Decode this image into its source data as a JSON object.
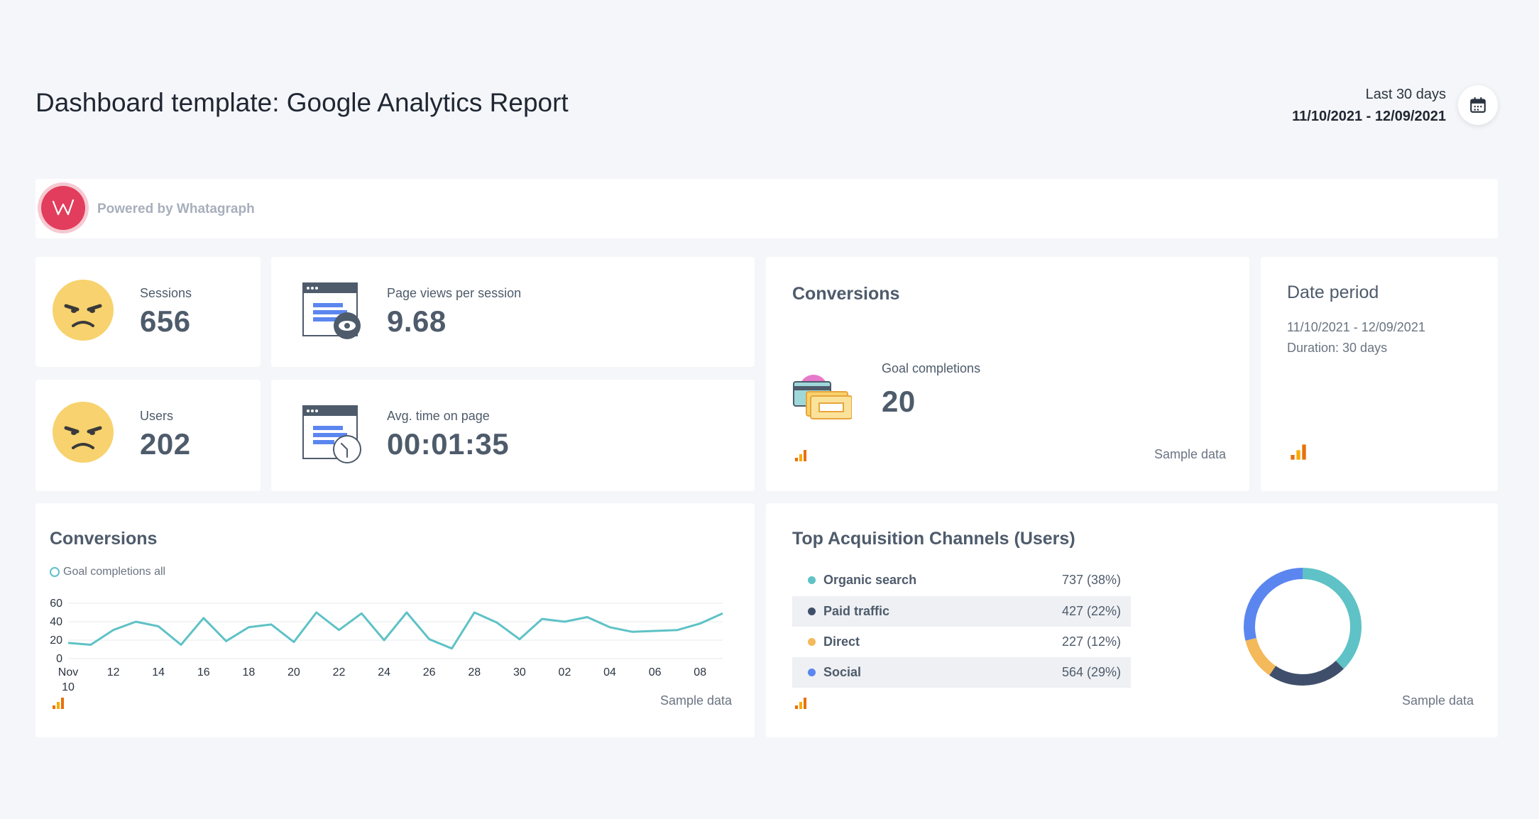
{
  "header": {
    "title": "Dashboard template: Google Analytics Report",
    "period_label": "Last 30 days",
    "period_range": "11/10/2021 - 12/09/2021"
  },
  "powered": {
    "text": "Powered by Whatagraph"
  },
  "kpis": {
    "sessions": {
      "label": "Sessions",
      "value": "656"
    },
    "pageviews": {
      "label": "Page views per session",
      "value": "9.68"
    },
    "users": {
      "label": "Users",
      "value": "202"
    },
    "avgtime": {
      "label": "Avg. time on page",
      "value": "00:01:35"
    }
  },
  "conversions_card": {
    "title": "Conversions",
    "metric_label": "Goal completions",
    "metric_value": "20",
    "sample": "Sample data"
  },
  "date_period": {
    "title": "Date period",
    "range": "11/10/2021 - 12/09/2021",
    "duration": "Duration:  30 days"
  },
  "conversions_chart": {
    "title": "Conversions",
    "legend": "Goal completions all",
    "sample": "Sample data",
    "x_tick_labels": [
      "Nov\n10",
      "12",
      "14",
      "16",
      "18",
      "20",
      "22",
      "24",
      "26",
      "28",
      "30",
      "02",
      "04",
      "06",
      "08"
    ],
    "y_tick_labels": [
      "60",
      "40",
      "20",
      "0"
    ]
  },
  "acquisition": {
    "title": "Top Acquisition Channels (Users)",
    "sample": "Sample data",
    "channels": [
      {
        "name": "Organic search",
        "value": "737  (38%)",
        "color": "#5ec2c6"
      },
      {
        "name": "Paid traffic",
        "value": "427  (22%)",
        "color": "#3f4f6b"
      },
      {
        "name": "Direct",
        "value": "227  (12%)",
        "color": "#f3b95a"
      },
      {
        "name": "Social",
        "value": "564  (29%)",
        "color": "#5b86f0"
      }
    ]
  },
  "chart_data": [
    {
      "type": "line",
      "title": "Conversions",
      "series": [
        {
          "name": "Goal completions all",
          "color": "#5ec2c6",
          "x": [
            "11-10",
            "11-11",
            "11-12",
            "11-13",
            "11-14",
            "11-15",
            "11-16",
            "11-17",
            "11-18",
            "11-19",
            "11-20",
            "11-21",
            "11-22",
            "11-23",
            "11-24",
            "11-25",
            "11-26",
            "11-27",
            "11-28",
            "11-29",
            "11-30",
            "12-01",
            "12-02",
            "12-03",
            "12-04",
            "12-05",
            "12-06",
            "12-07",
            "12-08",
            "12-09"
          ],
          "values": [
            17,
            15,
            31,
            40,
            35,
            15,
            44,
            19,
            34,
            37,
            18,
            50,
            31,
            49,
            20,
            50,
            21,
            11,
            50,
            39,
            21,
            43,
            40,
            45,
            34,
            29,
            30,
            31,
            38,
            49
          ]
        }
      ],
      "ylim": [
        0,
        60
      ],
      "grid": true,
      "legend": "top-left"
    },
    {
      "type": "pie",
      "title": "Top Acquisition Channels (Users)",
      "categories": [
        "Organic search",
        "Paid traffic",
        "Direct",
        "Social"
      ],
      "values": [
        737,
        427,
        227,
        564
      ],
      "colors": [
        "#5ec2c6",
        "#3f4f6b",
        "#f3b95a",
        "#5b86f0"
      ],
      "donut": true
    }
  ],
  "colors": {
    "accent_line": "#5ec2c6",
    "text_dark": "#4e5b6b",
    "brand": "#e23d5c",
    "background": "#f5f6f9"
  },
  "icons": {
    "calendar": "calendar-icon",
    "whatagraph": "whatagraph-logo-icon",
    "angry_face": "angry-face-icon",
    "browser_eye": "browser-eye-icon",
    "browser_clock": "browser-clock-icon",
    "payment_cards": "payment-cards-icon",
    "analytics_bars": "google-analytics-icon"
  }
}
